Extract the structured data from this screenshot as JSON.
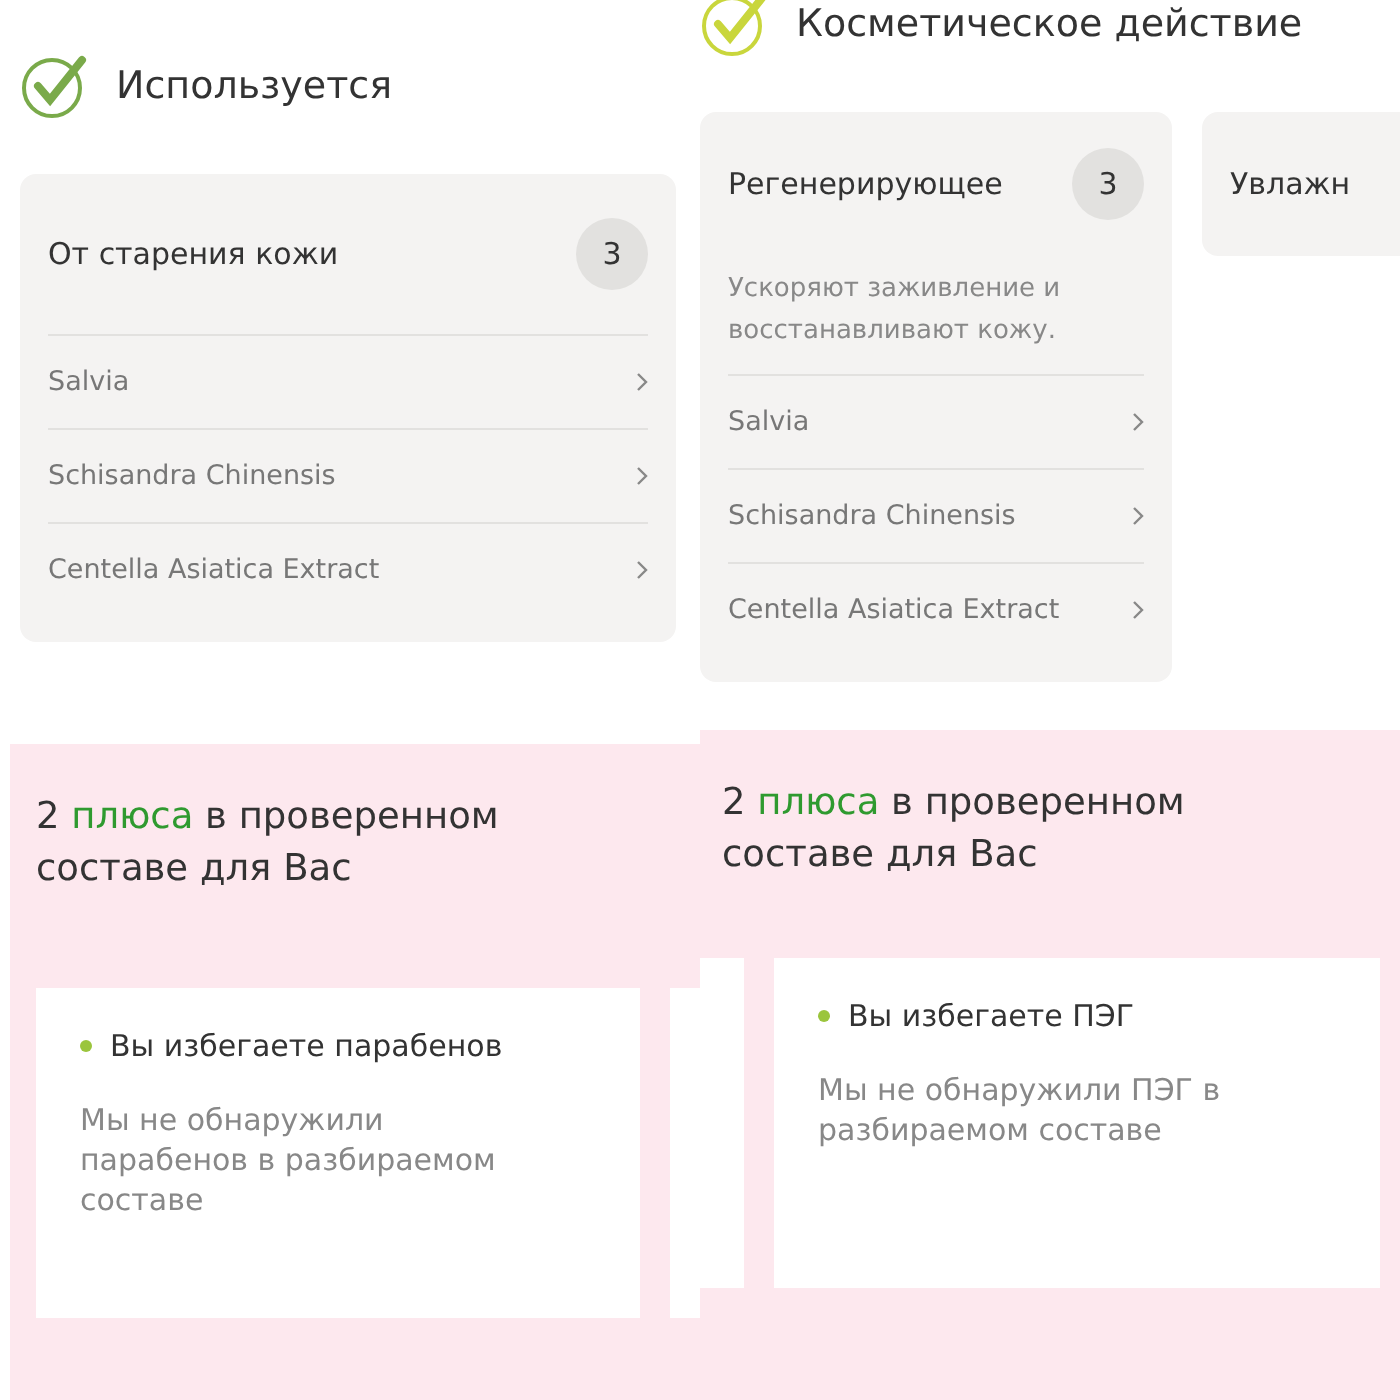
{
  "panels": [
    {
      "heading": "Используется",
      "color": "#7aaa4a",
      "categories": [
        {
          "title": "От старения кожи",
          "count": "3",
          "items": [
            "Salvia",
            "Schisandra Chinensis",
            "Centella Asiatica Extract"
          ]
        }
      ],
      "benefits": {
        "title": "2 **плюса** в проверенном составе для Вас",
        "cards": [
          {
            "title": "Вы избегаете парабенов",
            "text": "Мы не обнаружили парабенов в разбираемом составе"
          }
        ]
      }
    },
    {
      "heading": "Косметическое действие",
      "color": "#c9d63c",
      "categories": [
        {
          "title": "Регенерирующее",
          "count": "3",
          "description": "Ускоряют заживление и восстанавливают кожу.",
          "items": [
            "Salvia",
            "Schisandra Chinensis",
            "Centella Asiatica Extract"
          ]
        },
        {
          "title": "Увлажн"
        }
      ],
      "benefits": {
        "title": "2 **плюса** в проверенном составе для Вас",
        "cards": [
          {
            "title": "Вы избегаете ПЭГ",
            "text": "Мы не обнаружили ПЭГ в разбираемом составе"
          }
        ]
      }
    }
  ]
}
